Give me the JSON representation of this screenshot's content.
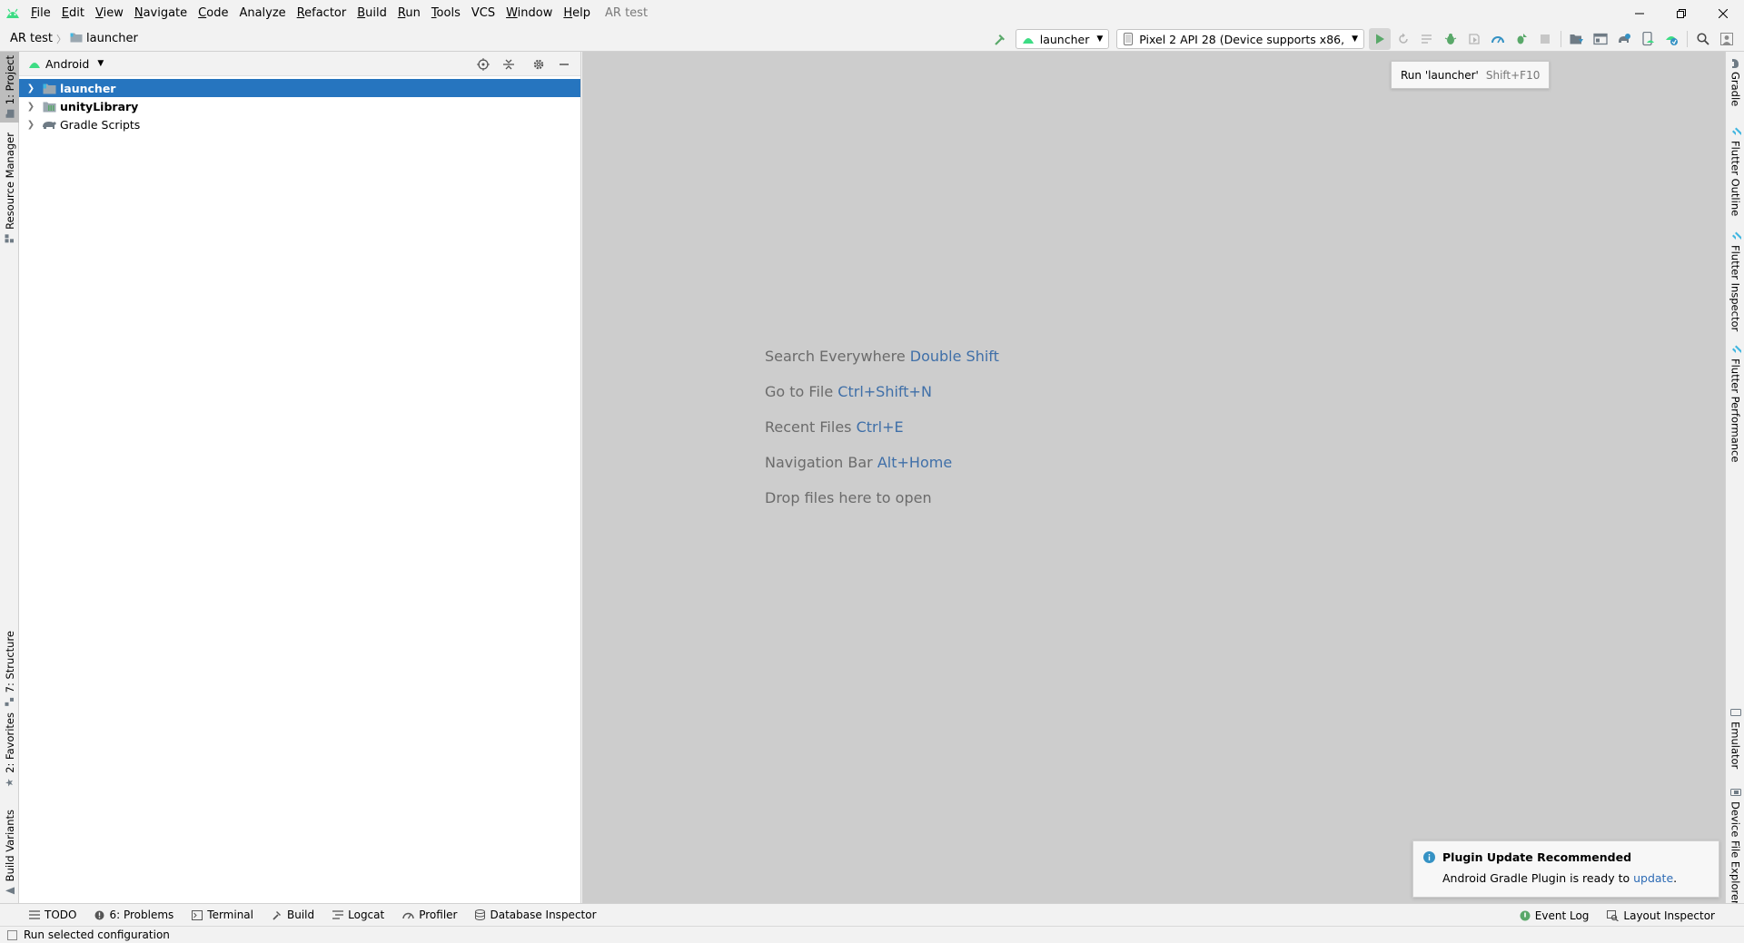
{
  "window": {
    "title": "AR test",
    "menu": [
      {
        "label": "File",
        "mnemonic": "F",
        "rest": "ile"
      },
      {
        "label": "Edit",
        "mnemonic": "E",
        "rest": "dit"
      },
      {
        "label": "View",
        "mnemonic": "V",
        "rest": "iew"
      },
      {
        "label": "Navigate",
        "mnemonic": "N",
        "rest": "avigate"
      },
      {
        "label": "Code",
        "mnemonic": "C",
        "rest": "ode"
      },
      {
        "label": "Analyze",
        "mnemonic": "",
        "rest": "Analyze"
      },
      {
        "label": "Refactor",
        "mnemonic": "R",
        "rest": "efactor"
      },
      {
        "label": "Build",
        "mnemonic": "B",
        "rest": "uild"
      },
      {
        "label": "Run",
        "mnemonic": "R",
        "rest": "un"
      },
      {
        "label": "Tools",
        "mnemonic": "T",
        "rest": "ools"
      },
      {
        "label": "VCS",
        "mnemonic": "",
        "rest": "VCS"
      },
      {
        "label": "Window",
        "mnemonic": "W",
        "rest": "indow"
      },
      {
        "label": "Help",
        "mnemonic": "H",
        "rest": "elp"
      }
    ]
  },
  "breadcrumb": {
    "root": "AR test",
    "module": "launcher"
  },
  "toolbar": {
    "run_config": "launcher",
    "device": "Pixel 2 API 28 (Device supports x86,"
  },
  "tooltip": {
    "label": "Run 'launcher'",
    "shortcut": "Shift+F10"
  },
  "left_strip": {
    "project": "1: Project",
    "resource_manager": "Resource Manager",
    "structure": "7: Structure",
    "favorites": "2: Favorites",
    "build_variants": "Build Variants"
  },
  "right_strip": {
    "gradle": "Gradle",
    "flutter_outline": "Flutter Outline",
    "flutter_inspector": "Flutter Inspector",
    "flutter_performance": "Flutter Performance",
    "emulator": "Emulator",
    "device_file_explorer": "Device File Explorer"
  },
  "project_panel": {
    "view_mode": "Android",
    "tree": [
      {
        "label": "launcher",
        "selected": true,
        "bold": true
      },
      {
        "label": "unityLibrary",
        "selected": false,
        "bold": true
      },
      {
        "label": "Gradle Scripts",
        "selected": false,
        "bold": false
      }
    ]
  },
  "editor_hints": [
    {
      "text": "Search Everywhere",
      "key": "Double Shift"
    },
    {
      "text": "Go to File",
      "key": "Ctrl+Shift+N"
    },
    {
      "text": "Recent Files",
      "key": "Ctrl+E"
    },
    {
      "text": "Navigation Bar",
      "key": "Alt+Home"
    },
    {
      "text": "Drop files here to open",
      "key": ""
    }
  ],
  "notification": {
    "title": "Plugin Update Recommended",
    "body": "Android Gradle Plugin is ready to",
    "link": "update",
    "trail": "."
  },
  "bottom_bar": {
    "todo": "TODO",
    "problems": "6: Problems",
    "terminal": "Terminal",
    "build": "Build",
    "logcat": "Logcat",
    "profiler": "Profiler",
    "database_inspector": "Database Inspector",
    "event_log": "Event Log",
    "layout_inspector": "Layout Inspector"
  },
  "status": {
    "message": "Run selected configuration"
  },
  "colors": {
    "android_green": "#3ddc84",
    "selection": "#2675bf",
    "run_green": "#59a869",
    "link_blue": "#2d6bb5"
  }
}
